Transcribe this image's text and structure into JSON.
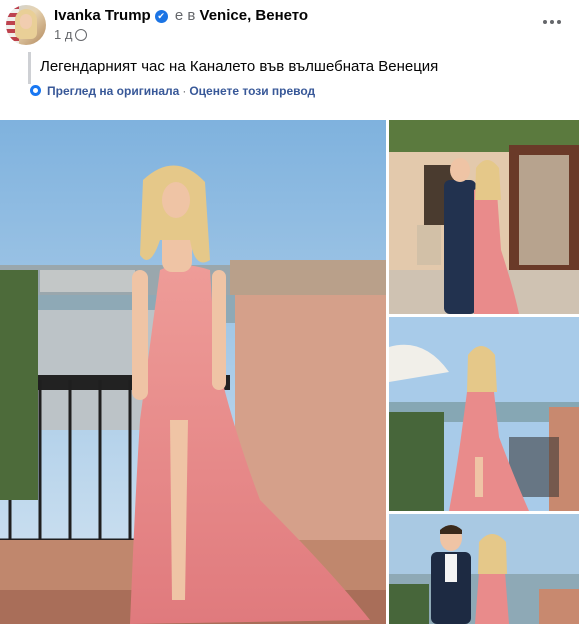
{
  "post": {
    "author": "Ivanka Trump",
    "verified_mark": "✔",
    "location_prefix": "е в",
    "location": "Venice, Венето",
    "timestamp": "1 д",
    "audience_icon": "globe-icon",
    "caption": "Легендарният час на Каналето във вълшебната Венеция",
    "translation": {
      "view_original": "Преглед на оригинала",
      "separator": "·",
      "rate_translation": "Оценете този превод"
    }
  },
  "photos": {
    "count": 4,
    "items": [
      "main-photo",
      "photo-2",
      "photo-3",
      "photo-4"
    ]
  },
  "colors": {
    "link": "#385898",
    "muted": "#65676b",
    "verified": "#1b74e4",
    "dress": "#e98b8b"
  }
}
